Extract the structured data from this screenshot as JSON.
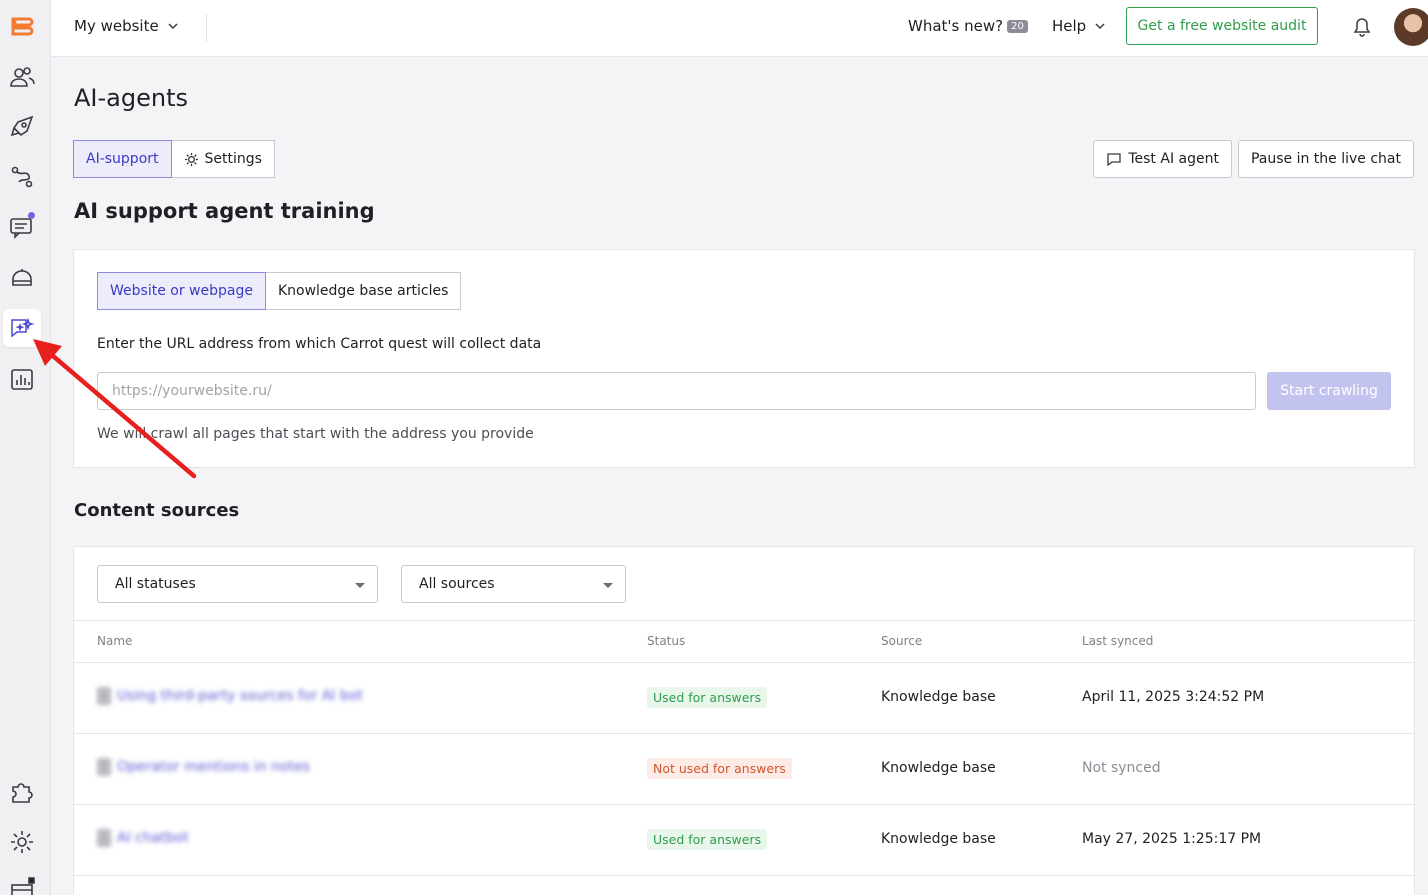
{
  "sidebar": {
    "items": [
      {
        "icon": "logo-icon"
      },
      {
        "icon": "users-icon"
      },
      {
        "icon": "rocket-icon"
      },
      {
        "icon": "workflow-icon"
      },
      {
        "icon": "chat-icon"
      },
      {
        "icon": "bot-icon"
      },
      {
        "icon": "ai-agent-icon",
        "active": true
      },
      {
        "icon": "reports-icon"
      },
      {
        "icon": "integrations-icon"
      },
      {
        "icon": "settings-icon"
      }
    ]
  },
  "header": {
    "site_name": "My website",
    "whats_new": "What's new?",
    "whats_new_count": "20",
    "help": "Help",
    "audit_button": "Get a free website audit"
  },
  "page": {
    "title": "AI-agents",
    "tabs": [
      {
        "label": "AI-support",
        "active": true
      },
      {
        "label": "Settings"
      }
    ],
    "actions": {
      "test": "Test AI agent",
      "pause": "Pause in the live chat"
    },
    "section_title": "AI support agent training"
  },
  "training": {
    "tabs": [
      {
        "label": "Website or webpage",
        "active": true
      },
      {
        "label": "Knowledge base articles"
      }
    ],
    "url_label": "Enter the URL address from which Carrot quest will collect data",
    "url_placeholder": "https://yourwebsite.ru/",
    "crawl_button": "Start crawling",
    "hint": "We will crawl all pages that start with the address you provide"
  },
  "sources": {
    "title": "Content sources",
    "status_filter": "All statuses",
    "source_filter": "All sources",
    "columns": {
      "name": "Name",
      "status": "Status",
      "source": "Source",
      "last_synced": "Last synced"
    },
    "rows": [
      {
        "name": "Using third-party sources for AI bot",
        "status": "Used for answers",
        "source": "Knowledge base",
        "last_synced": "April 11, 2025 3:24:52 PM"
      },
      {
        "name": "Operator mentions in notes",
        "status": "Not used for answers",
        "source": "Knowledge base",
        "last_synced": "Not synced"
      },
      {
        "name": "AI chatbot",
        "status": "Used for answers",
        "source": "Knowledge base",
        "last_synced": "May 27, 2025 1:25:17 PM"
      }
    ]
  },
  "colors": {
    "accent": "#5b5bd6",
    "success": "#2f9d4a",
    "danger": "#d4552f",
    "annotation_arrow": "#e8201d"
  }
}
